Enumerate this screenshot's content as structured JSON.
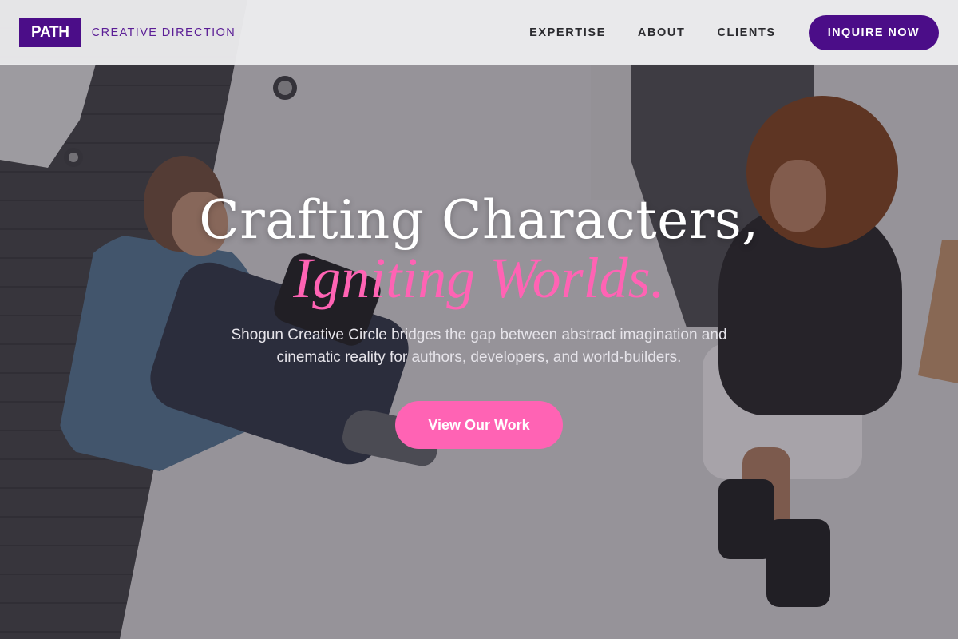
{
  "header": {
    "logo": "PATH",
    "tagline": "CREATIVE DIRECTION",
    "nav": [
      {
        "label": "EXPERTISE"
      },
      {
        "label": "ABOUT"
      },
      {
        "label": "CLIENTS"
      }
    ],
    "cta_label": "INQUIRE NOW"
  },
  "hero": {
    "title_line1": "Crafting Characters,",
    "title_line2": "Igniting Worlds.",
    "subtitle": "Shogun Creative Circle bridges the gap between abstract imagination and cinematic reality for authors, developers, and world-builders.",
    "button_label": "View Our Work"
  },
  "colors": {
    "brand_purple": "#4b0d88",
    "accent_pink": "#ff63b4"
  }
}
